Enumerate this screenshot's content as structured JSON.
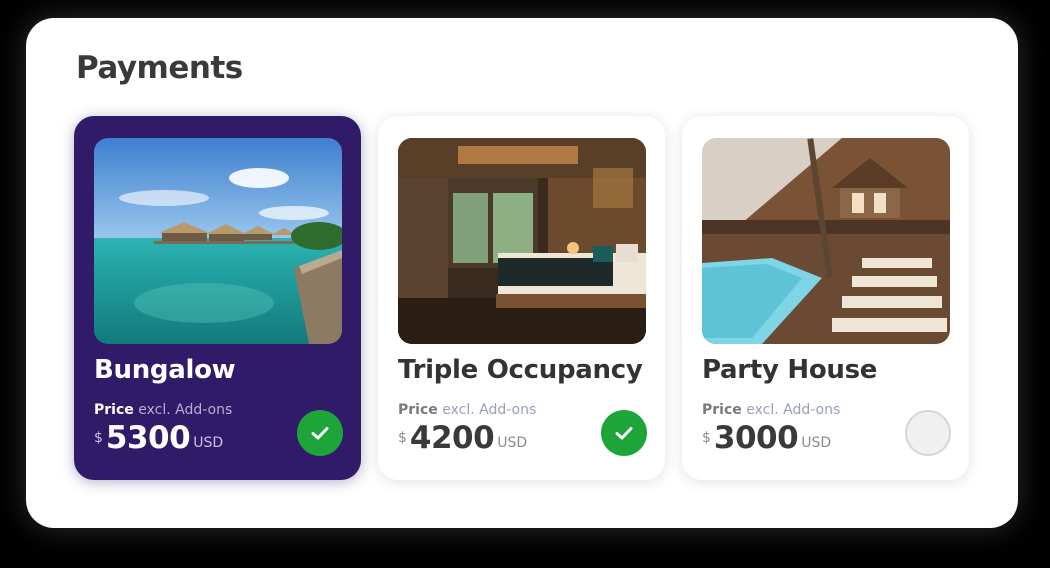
{
  "page": {
    "title": "Payments"
  },
  "cards": [
    {
      "name": "Bungalow",
      "price_word": "Price",
      "price_note": "excl. Add-ons",
      "currency": "$",
      "amount": "5300",
      "unit": "USD",
      "selected": true,
      "checked": true
    },
    {
      "name": "Triple Occupancy",
      "price_word": "Price",
      "price_note": "excl. Add-ons",
      "currency": "$",
      "amount": "4200",
      "unit": "USD",
      "selected": false,
      "checked": true
    },
    {
      "name": "Party House",
      "price_word": "Price",
      "price_note": "excl. Add-ons",
      "currency": "$",
      "amount": "3000",
      "unit": "USD",
      "selected": false,
      "checked": false
    }
  ],
  "icons": {
    "check": "check-icon"
  },
  "colors": {
    "selected_card": "#301b68",
    "check_green": "#1ea53a",
    "title_text": "#3a3a3a"
  }
}
